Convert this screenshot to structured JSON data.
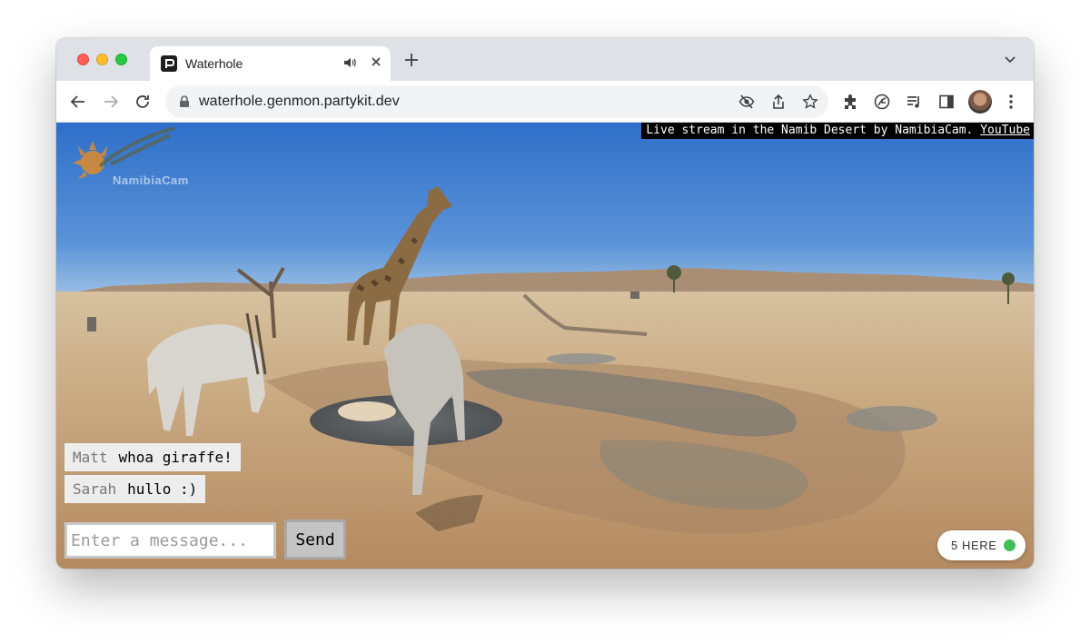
{
  "browser": {
    "tab_title": "Waterhole",
    "url": "waterhole.genmon.partykit.dev",
    "icons": [
      "back-arrow-icon",
      "forward-arrow-icon",
      "reload-icon",
      "lock-icon",
      "eye-off-icon",
      "share-icon",
      "star-icon",
      "extensions-icon",
      "leaf-icon",
      "reading-list-icon",
      "side-panel-icon",
      "more-icon"
    ]
  },
  "stream": {
    "credit_text": "Live stream in the Namib Desert by NamibiaCam.",
    "credit_link": "YouTube",
    "watermark": "NamibiaCam"
  },
  "chat": {
    "messages": [
      {
        "name": "Matt",
        "text": "whoa giraffe!"
      },
      {
        "name": "Sarah",
        "text": "hullo :)"
      }
    ],
    "input_placeholder": "Enter a message...",
    "send_label": "Send"
  },
  "presence": {
    "label": "5 HERE",
    "count": 5,
    "dot_color": "#3ec15a"
  }
}
